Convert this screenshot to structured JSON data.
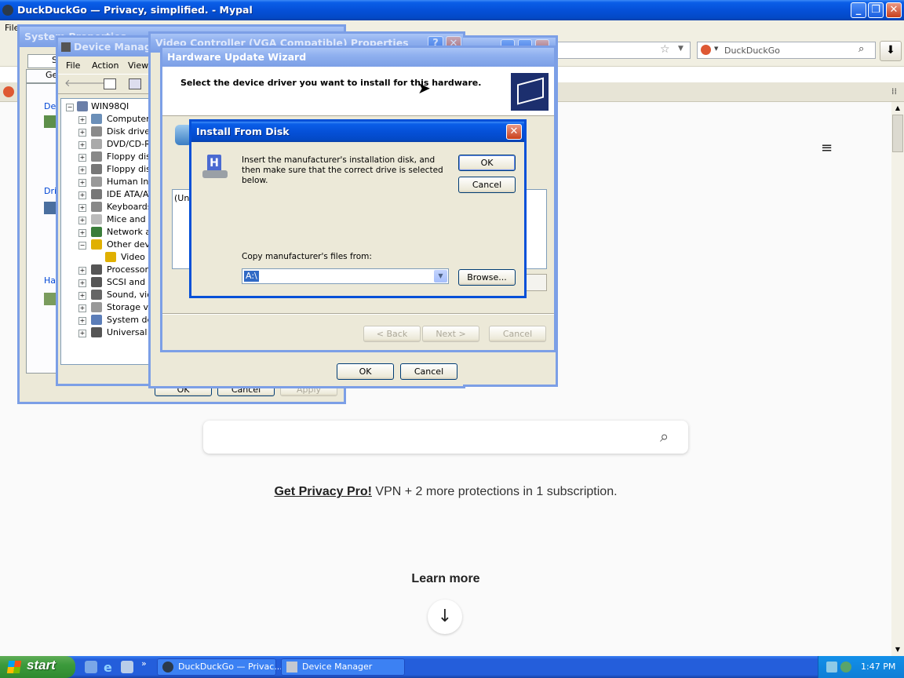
{
  "browser": {
    "title": "DuckDuckGo — Privacy, simplified. - Mypal",
    "menu_first": "File",
    "search_box_value": "DuckDuckGo",
    "page": {
      "promo_link": "Get Privacy Pro!",
      "promo_text": " VPN + 2 more protections in 1 subscription.",
      "learn_more": "Learn more",
      "search_placeholder": ""
    }
  },
  "system_properties": {
    "title": "System Properties",
    "tab_partial_1": "S",
    "tab_partial_2": "Ge",
    "group_partial_1": "Dev",
    "group_partial_2": "Driv",
    "group_partial_3": "Har",
    "ok": "OK",
    "cancel": "Cancel",
    "apply": "Apply"
  },
  "device_manager": {
    "title": "Device Manager",
    "menus": [
      "File",
      "Action",
      "View"
    ],
    "root": "WIN98QI",
    "items": [
      {
        "label": "Computer"
      },
      {
        "label": "Disk drives"
      },
      {
        "label": "DVD/CD-RO"
      },
      {
        "label": "Floppy disk"
      },
      {
        "label": "Floppy disk"
      },
      {
        "label": "Human Inte"
      },
      {
        "label": "IDE ATA/AT"
      },
      {
        "label": "Keyboards"
      },
      {
        "label": "Mice and ot"
      },
      {
        "label": "Network ac"
      },
      {
        "label": "Other devic"
      },
      {
        "label": "Video C"
      },
      {
        "label": "Processors"
      },
      {
        "label": "SCSI and R"
      },
      {
        "label": "Sound, vide"
      },
      {
        "label": "Storage vo"
      },
      {
        "label": "System dev"
      },
      {
        "label": "Universal S"
      }
    ]
  },
  "video_controller": {
    "title": "Video Controller (VGA Compatible) Properties",
    "ok": "OK",
    "cancel": "Cancel"
  },
  "wizard": {
    "title": "Hardware Update Wizard",
    "heading": "Select the device driver you want to install for this hardware.",
    "list_partial": "(Una",
    "back": "< Back",
    "next": "Next >",
    "cancel": "Cancel"
  },
  "install_from_disk": {
    "title": "Install From Disk",
    "message": "Insert the manufacturer's installation disk, and then make sure that the correct drive is selected below.",
    "ok": "OK",
    "cancel": "Cancel",
    "copy_label": "Copy manufacturer's files from:",
    "path_value": "A:\\",
    "browse": "Browse..."
  },
  "taskbar": {
    "start": "start",
    "tasks": [
      {
        "label": "DuckDuckGo — Privac..."
      },
      {
        "label": "Device Manager"
      }
    ],
    "clock": "1:47 PM"
  },
  "colors": {
    "xp_blue": "#0550d8",
    "taskbar_blue": "#245edb",
    "start_green": "#3c9a3c",
    "dialog_bg": "#ece9d8"
  }
}
